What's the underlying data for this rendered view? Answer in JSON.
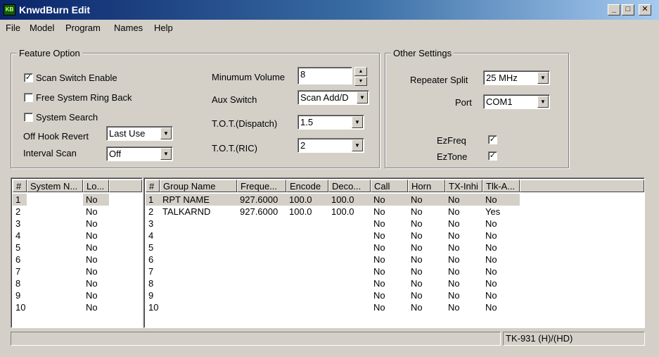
{
  "window": {
    "title": "KnwdBurn Edit",
    "icon_text": "KB",
    "minimize": "_",
    "maximize": "□",
    "close": "✕"
  },
  "menu": [
    "File",
    "Model",
    "Program",
    "Names",
    "Help"
  ],
  "feature_option": {
    "legend": "Feature Option",
    "scan_switch": {
      "label": "Scan Switch Enable",
      "checked": true
    },
    "free_ring_back": {
      "label": "Free System Ring Back",
      "checked": false
    },
    "system_search": {
      "label": "System Search",
      "checked": false
    },
    "off_hook_revert": {
      "label": "Off Hook Revert",
      "value": "Last Use"
    },
    "interval_scan": {
      "label": "Interval Scan",
      "value": "Off"
    },
    "min_volume": {
      "label": "Minumum Volume",
      "value": "8"
    },
    "aux_switch": {
      "label": "Aux Switch",
      "value": "Scan Add/D"
    },
    "tot_dispatch": {
      "label": "T.O.T.(Dispatch)",
      "value": "1.5"
    },
    "tot_ric": {
      "label": "T.O.T.(RIC)",
      "value": "2"
    }
  },
  "other_settings": {
    "legend": "Other Settings",
    "repeater_split": {
      "label": "Repeater Split",
      "value": "25 MHz"
    },
    "port": {
      "label": "Port",
      "value": "COM1"
    },
    "ezfreq": {
      "label": "EzFreq",
      "checked": true
    },
    "eztone": {
      "label": "EzTone",
      "checked": true
    }
  },
  "system_table": {
    "headers": [
      "#",
      "System N...",
      "Lo..."
    ],
    "rows": [
      [
        "1",
        "",
        "No"
      ],
      [
        "2",
        "",
        "No"
      ],
      [
        "3",
        "",
        "No"
      ],
      [
        "4",
        "",
        "No"
      ],
      [
        "5",
        "",
        "No"
      ],
      [
        "6",
        "",
        "No"
      ],
      [
        "7",
        "",
        "No"
      ],
      [
        "8",
        "",
        "No"
      ],
      [
        "9",
        "",
        "No"
      ],
      [
        "10",
        "",
        "No"
      ]
    ],
    "selected_row": 0
  },
  "group_table": {
    "headers": [
      "#",
      "Group Name",
      "Freque...",
      "Encode",
      "Deco...",
      "Call",
      "Horn",
      "TX-Inhi",
      "Tlk-A..."
    ],
    "rows": [
      [
        "1",
        "RPT NAME",
        "927.6000",
        "100.0",
        "100.0",
        "No",
        "No",
        "No",
        "No"
      ],
      [
        "2",
        "TALKARND",
        "927.6000",
        "100.0",
        "100.0",
        "No",
        "No",
        "No",
        "Yes"
      ],
      [
        "3",
        "",
        "",
        "",
        "",
        "No",
        "No",
        "No",
        "No"
      ],
      [
        "4",
        "",
        "",
        "",
        "",
        "No",
        "No",
        "No",
        "No"
      ],
      [
        "5",
        "",
        "",
        "",
        "",
        "No",
        "No",
        "No",
        "No"
      ],
      [
        "6",
        "",
        "",
        "",
        "",
        "No",
        "No",
        "No",
        "No"
      ],
      [
        "7",
        "",
        "",
        "",
        "",
        "No",
        "No",
        "No",
        "No"
      ],
      [
        "8",
        "",
        "",
        "",
        "",
        "No",
        "No",
        "No",
        "No"
      ],
      [
        "9",
        "",
        "",
        "",
        "",
        "No",
        "No",
        "No",
        "No"
      ],
      [
        "10",
        "",
        "",
        "",
        "",
        "No",
        "No",
        "No",
        "No"
      ]
    ],
    "selected_row": 0
  },
  "status": {
    "left": "",
    "model": "TK-931 (H)/(HD)"
  }
}
